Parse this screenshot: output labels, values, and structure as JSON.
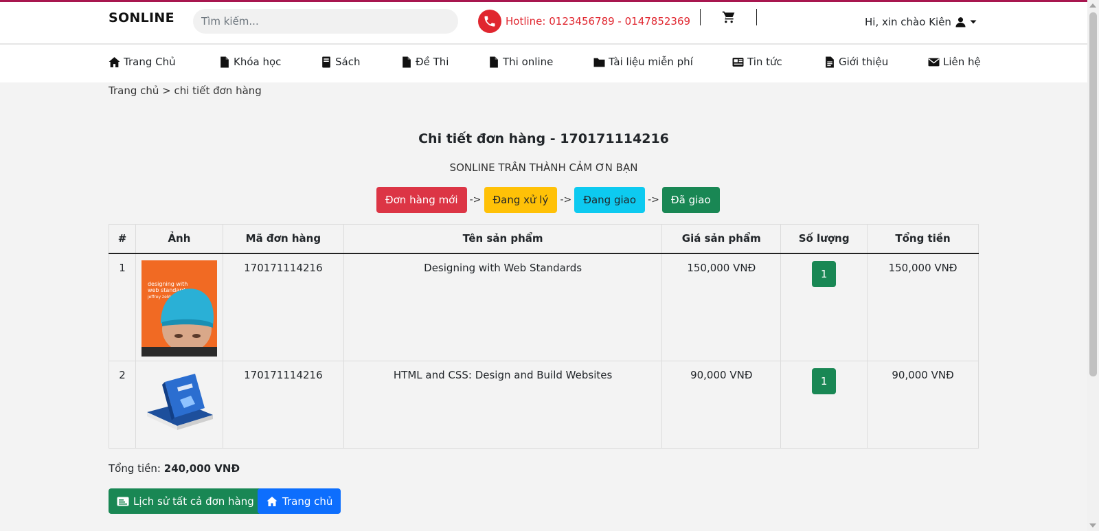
{
  "header": {
    "logo": "SONLINE",
    "search_placeholder": "Tìm kiếm...",
    "hotline": "Hotline: 0123456789 - 0147852369",
    "greeting": "Hi, xin chào Kiên"
  },
  "nav": {
    "items": [
      {
        "label": "Trang Chủ",
        "icon": "home-icon"
      },
      {
        "label": "Khóa học",
        "icon": "file-icon"
      },
      {
        "label": "Sách",
        "icon": "book-icon"
      },
      {
        "label": "Đề Thi",
        "icon": "file-icon"
      },
      {
        "label": "Thi online",
        "icon": "file-icon"
      },
      {
        "label": "Tài liệu miễn phí",
        "icon": "folder-icon"
      },
      {
        "label": "Tin tức",
        "icon": "newspaper-icon"
      },
      {
        "label": "Giới thiệu",
        "icon": "file-text-icon"
      },
      {
        "label": "Liên hệ",
        "icon": "envelope-icon"
      }
    ]
  },
  "breadcrumb": "Trang chủ > chi tiết đơn hàng",
  "order": {
    "title": "Chi tiết đơn hàng - 170171114216",
    "thanks": "SONLINE TRÂN THÀNH CẢM ƠN BẠN",
    "status_steps": [
      {
        "label": "Đơn hàng mới",
        "bg": "#dc3545",
        "fg": "#ffffff"
      },
      {
        "label": "Đang xử lý",
        "bg": "#ffc107",
        "fg": "#212529"
      },
      {
        "label": "Đang giao",
        "bg": "#0dcaf0",
        "fg": "#212529"
      },
      {
        "label": "Đã giao",
        "bg": "#198754",
        "fg": "#ffffff"
      }
    ],
    "arrow": "->",
    "columns": [
      "#",
      "Ảnh",
      "Mã đơn hàng",
      "Tên sản phẩm",
      "Giá sản phẩm",
      "Số lượng",
      "Tổng tiền"
    ],
    "rows": [
      {
        "index": "1",
        "code": "170171114216",
        "name": "Designing with Web Standards",
        "price": "150,000 VNĐ",
        "qty": "1",
        "total": "150,000 VNĐ",
        "cover_title": "designing with web standards",
        "cover_author": "jeffrey zeldman"
      },
      {
        "index": "2",
        "code": "170171114216",
        "name": "HTML and CSS: Design and Build Websites",
        "price": "90,000 VNĐ",
        "qty": "1",
        "total": "90,000 VNĐ"
      }
    ],
    "total_label": "Tổng tiền:",
    "total_value": "240,000 VNĐ"
  },
  "actions": {
    "history": "Lịch sử tất cả đơn hàng",
    "home": "Trang chủ"
  },
  "colors": {
    "brand_line": "#a8164f",
    "hotline": "#e0262f",
    "success": "#198754",
    "primary": "#0d6efd"
  }
}
